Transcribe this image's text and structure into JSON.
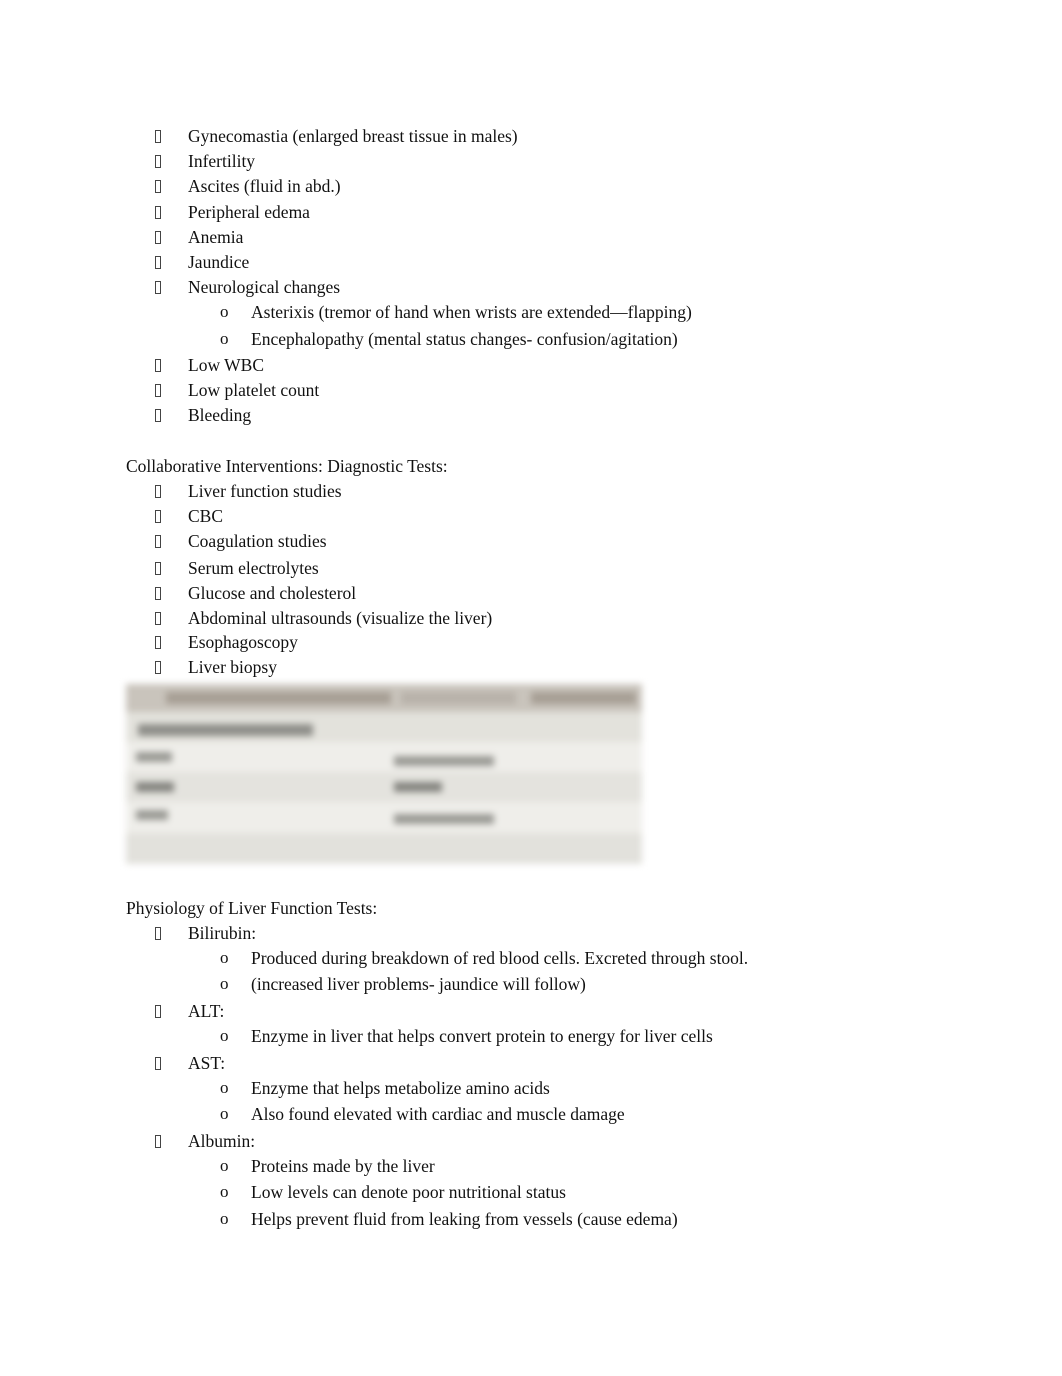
{
  "section_manifestations": {
    "items": [
      {
        "label": "Gynecomastia (enlarged breast tissue in males)"
      },
      {
        "label": "Infertility"
      },
      {
        "label": "Ascites (fluid in abd.)"
      },
      {
        "label": "Peripheral edema"
      },
      {
        "label": "Anemia"
      },
      {
        "label": "Jaundice"
      },
      {
        "label": "Neurological changes",
        "subitems": [
          "Asterixis (tremor of hand when wrists are extended—flapping)",
          "Encephalopathy (mental status changes- confusion/agitation)"
        ]
      },
      {
        "label": "Low WBC"
      },
      {
        "label": "Low platelet count"
      },
      {
        "label": "Bleeding"
      }
    ]
  },
  "section_diagnostics": {
    "heading": "Collaborative Interventions: Diagnostic Tests:",
    "items": [
      "Liver function studies",
      "CBC",
      "Coagulation studies",
      "Serum electrolytes",
      "Glucose and cholesterol",
      "Abdominal ultrasounds (visualize the liver)",
      "Esophagoscopy",
      "Liver biopsy"
    ]
  },
  "blurred_table": {
    "note": "content obscured (blurred)"
  },
  "section_physiology": {
    "heading": "Physiology of Liver Function Tests:",
    "items": [
      {
        "label": "Bilirubin:",
        "subitems": [
          "Produced during breakdown of red blood cells. Excreted through stool.",
          "(increased liver problems- jaundice will follow)"
        ]
      },
      {
        "label": "ALT:",
        "subitems": [
          "Enzyme in liver that helps convert protein to energy for liver cells"
        ]
      },
      {
        "label": "AST:",
        "subitems": [
          "Enzyme that helps metabolize amino acids",
          "Also found elevated with cardiac and muscle damage"
        ]
      },
      {
        "label": "Albumin:",
        "subitems": [
          "Proteins made by the liver",
          "Low levels can denote poor nutritional status",
          "Helps prevent fluid from leaking from vessels (cause edema)"
        ]
      }
    ]
  },
  "glyphs": {
    "sub_bullet": "o"
  }
}
